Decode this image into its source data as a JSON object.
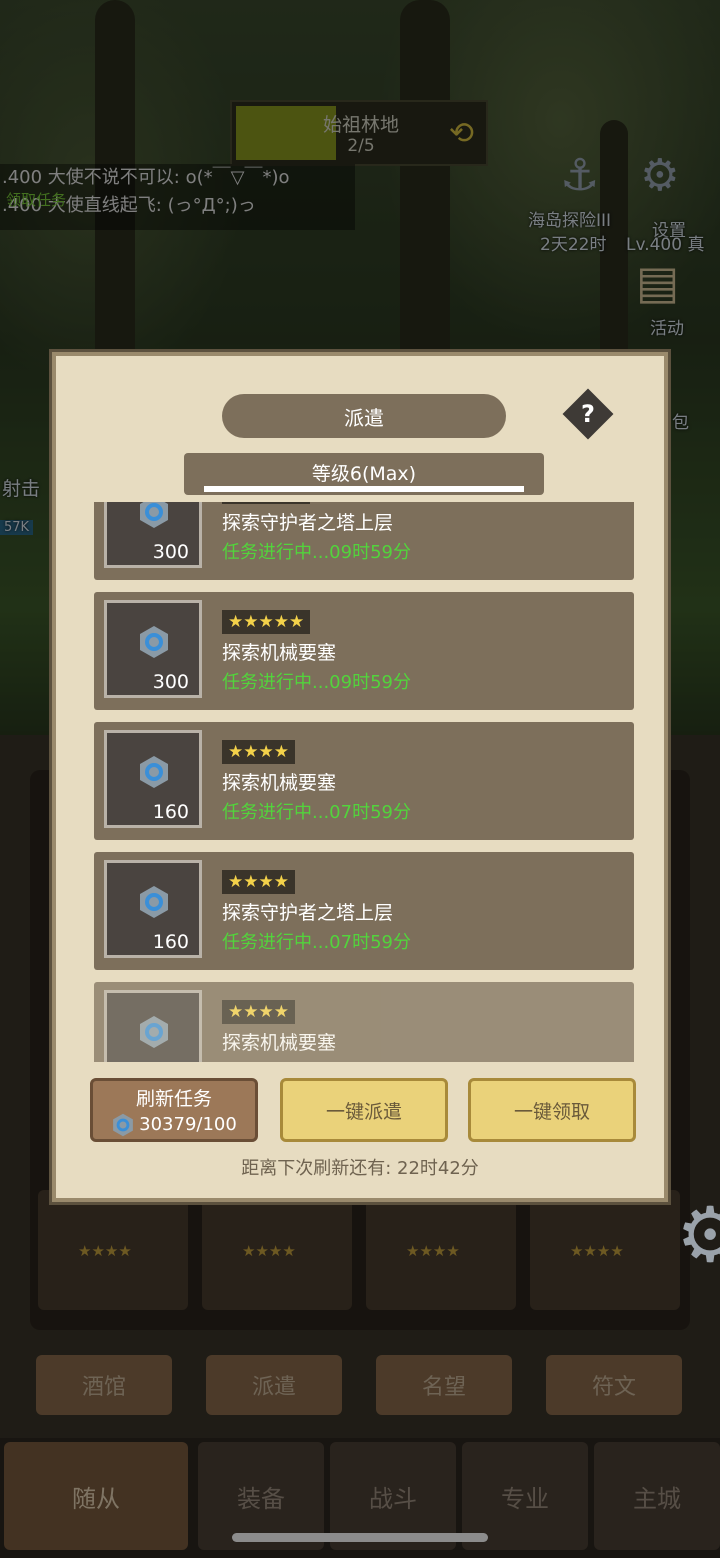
{
  "hud": {
    "zone_title": "始祖林地",
    "zone_count": "2/5",
    "chat": [
      ".400 大使不说不可以: o(*￣▽￣*)o",
      ".400 大使直线起飞: (っ°Д°;)っ"
    ],
    "chat_overlay": "领取任务",
    "event_label": "海岛探险III",
    "event_timer": "2天22时",
    "settings_label": "设置",
    "player_label": "Lv.400 真",
    "activity_label": "活动",
    "bag_label": "包",
    "left_label": "射击",
    "left_badge": "57K"
  },
  "modal": {
    "title": "派遣",
    "help": "?",
    "level": "等级6(Max)",
    "tasks": [
      {
        "stars": "★★★★★",
        "name": "探索守护者之塔上层",
        "status": "任务进行中...09时59分",
        "reward": "300"
      },
      {
        "stars": "★★★★★",
        "name": "探索机械要塞",
        "status": "任务进行中...09时59分",
        "reward": "300"
      },
      {
        "stars": "★★★★",
        "name": "探索机械要塞",
        "status": "任务进行中...07时59分",
        "reward": "160"
      },
      {
        "stars": "★★★★",
        "name": "探索守护者之塔上层",
        "status": "任务进行中...07时59分",
        "reward": "160"
      },
      {
        "stars": "★★★★",
        "name": "探索机械要塞",
        "status": "",
        "reward": ""
      }
    ],
    "refresh_label": "刷新任务",
    "refresh_cost": "30379/100",
    "dispatch_all": "一键派遣",
    "claim_all": "一键领取",
    "next_refresh": "距离下次刷新还有: 22时42分"
  },
  "bottom": {
    "hero_stars": "★★★★",
    "tabs": [
      "酒馆",
      "派遣",
      "名望",
      "符文"
    ],
    "nav": [
      "随从",
      "装备",
      "战斗",
      "专业",
      "主城"
    ]
  },
  "colors": {
    "panel_bg": "#e7dcc1",
    "task_bg": "#7d6f5b",
    "status_green": "#52d43c",
    "star_gold": "#f4d24a",
    "button_yellow": "#ead27a"
  }
}
